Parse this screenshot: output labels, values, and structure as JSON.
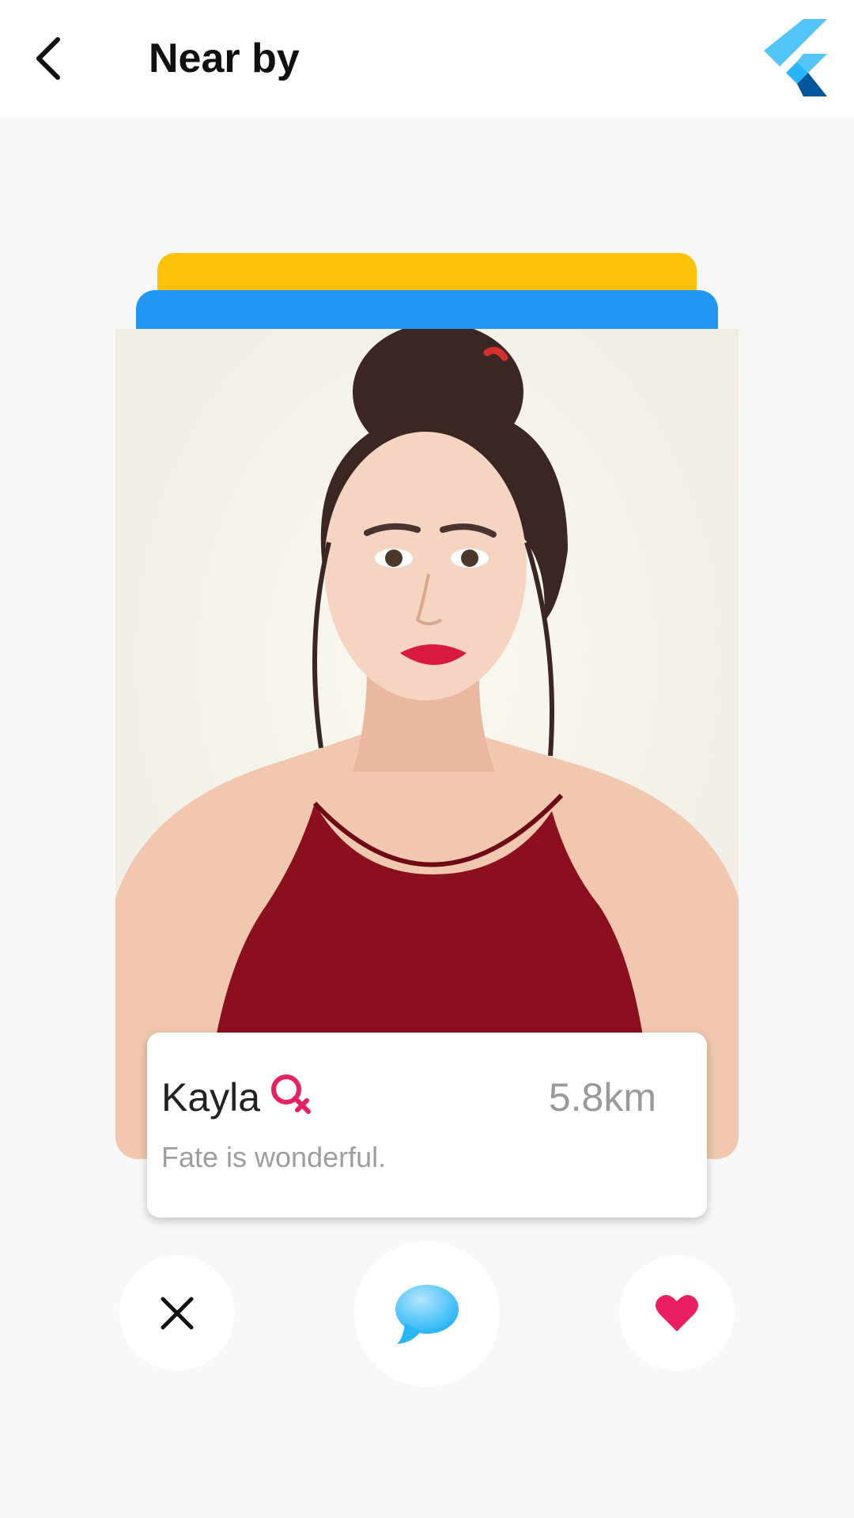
{
  "appbar": {
    "title": "Near by",
    "back_icon": "chevron-left-icon",
    "logo_icon": "flutter-logo"
  },
  "profile": {
    "name": "Kayla",
    "gender_icon": "female-symbol-icon",
    "distance": "5.8km",
    "bio": "Fate is wonderful.",
    "photo": "profile-photo"
  },
  "actions": {
    "dislike_icon": "close-icon",
    "chat_icon": "chat-bubble-icon",
    "like_icon": "heart-icon"
  },
  "colors": {
    "background": "#f8f8f8",
    "stack_yellow": "#ffc107",
    "stack_blue": "#2196f3",
    "accent_pink": "#e91e63",
    "chat_blue": "#4fc3f7",
    "logo_light": "#54c5f8",
    "logo_dark": "#01579b"
  }
}
